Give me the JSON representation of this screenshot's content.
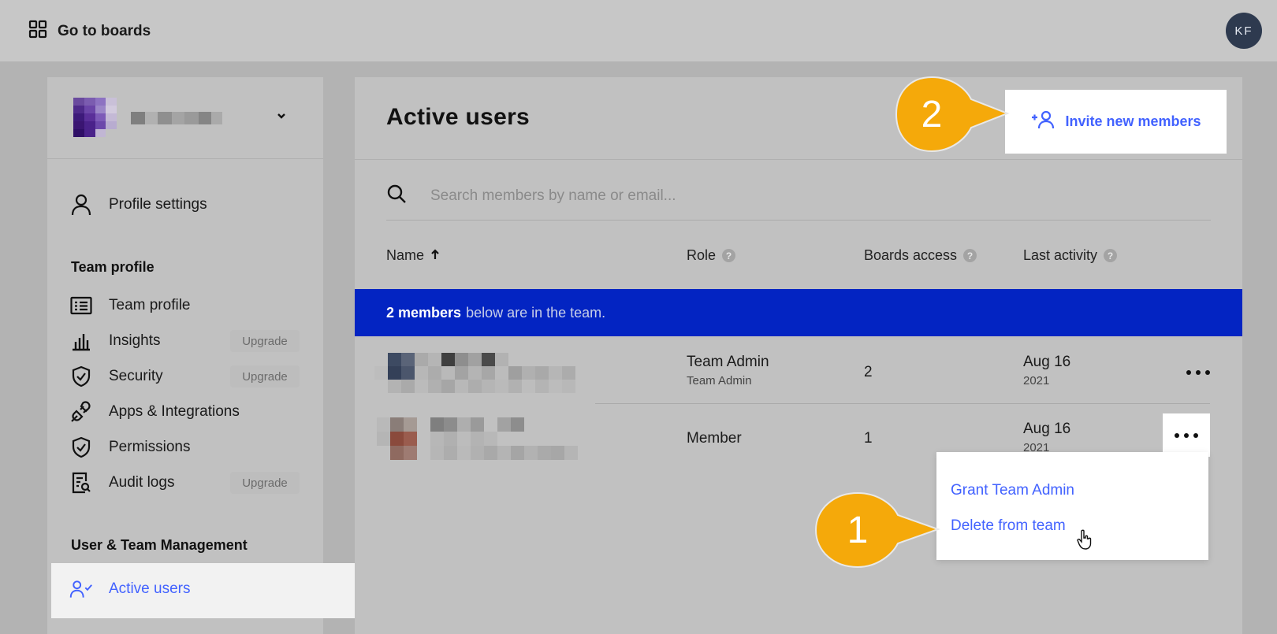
{
  "topbar": {
    "go_to_boards": "Go to boards",
    "avatar_initials": "KF"
  },
  "sidebar": {
    "profile_settings": "Profile settings",
    "team_profile_heading": "Team profile",
    "items": [
      {
        "label": "Team profile",
        "badge": ""
      },
      {
        "label": "Insights",
        "badge": "Upgrade"
      },
      {
        "label": "Security",
        "badge": "Upgrade"
      },
      {
        "label": "Apps & Integrations",
        "badge": ""
      },
      {
        "label": "Permissions",
        "badge": ""
      },
      {
        "label": "Audit logs",
        "badge": "Upgrade"
      }
    ],
    "user_mgmt_heading": "User & Team Management",
    "active_users": "Active users"
  },
  "main": {
    "title": "Active users",
    "invite_label": "Invite new members",
    "search_placeholder": "Search members by name or email...",
    "columns": {
      "name": "Name",
      "role": "Role",
      "boards_access": "Boards access",
      "last_activity": "Last activity"
    },
    "banner": {
      "count": "2 members",
      "text": "below are in the team."
    },
    "rows": [
      {
        "role": "Team Admin",
        "role_sub": "Team Admin",
        "boards": "2",
        "date": "Aug 16",
        "year": "2021"
      },
      {
        "role": "Member",
        "role_sub": "",
        "boards": "1",
        "date": "Aug 16",
        "year": "2021"
      }
    ],
    "menu": {
      "grant": "Grant Team Admin",
      "delete": "Delete from team"
    }
  },
  "callouts": {
    "first": "1",
    "second": "2"
  },
  "colors": {
    "accent": "#4262ff",
    "banner": "#0324c2",
    "callout": "#f5a90a"
  }
}
